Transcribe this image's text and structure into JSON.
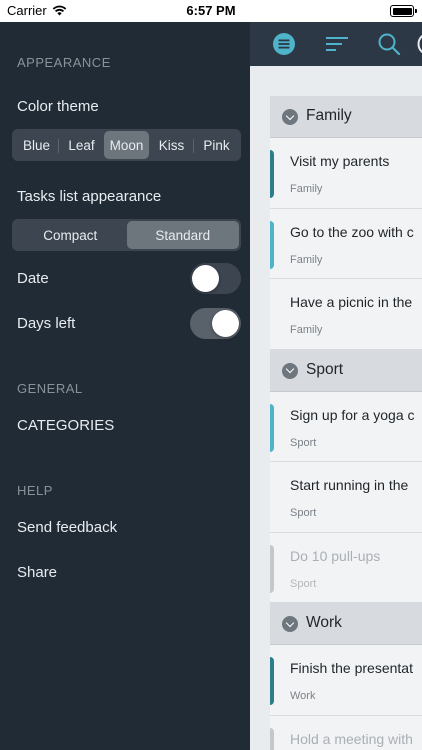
{
  "status_bar": {
    "carrier": "Carrier",
    "time": "6:57 PM"
  },
  "sidebar": {
    "appearance_header": "APPEARANCE",
    "color_theme_label": "Color theme",
    "color_themes": [
      "Blue",
      "Leaf",
      "Moon",
      "Kiss",
      "Pink"
    ],
    "color_theme_selected": "Moon",
    "tasks_list_label": "Tasks list appearance",
    "tasks_list_options": [
      "Compact",
      "Standard"
    ],
    "tasks_list_selected": "Standard",
    "date_label": "Date",
    "date_toggle": false,
    "days_left_label": "Days left",
    "days_left_toggle": true,
    "general_header": "GENERAL",
    "categories_label": "CATEGORIES",
    "help_header": "HELP",
    "send_feedback_label": "Send feedback",
    "share_label": "Share"
  },
  "toolbar": {
    "icons": [
      "menu-icon",
      "sort-icon",
      "search-icon"
    ],
    "accent": "#4fb3c9"
  },
  "categories": [
    {
      "name": "Family",
      "tasks": [
        {
          "title": "Visit my parents",
          "category": "Family",
          "done": false,
          "marker": "#2b7f8c"
        },
        {
          "title": "Go to the zoo with c",
          "category": "Family",
          "done": false,
          "marker": "#4fb3c9"
        },
        {
          "title": "Have a picnic in the",
          "category": "Family",
          "done": false,
          "marker": ""
        }
      ]
    },
    {
      "name": "Sport",
      "tasks": [
        {
          "title": "Sign up for a yoga c",
          "category": "Sport",
          "done": false,
          "marker": "#4fb3c9"
        },
        {
          "title": "Start running in the",
          "category": "Sport",
          "done": false,
          "marker": ""
        },
        {
          "title": "Do 10 pull-ups",
          "category": "Sport",
          "done": true,
          "marker": "#c4c8cc"
        }
      ]
    },
    {
      "name": "Work",
      "tasks": [
        {
          "title": "Finish the presentat",
          "category": "Work",
          "done": false,
          "marker": "#2b7f8c"
        },
        {
          "title": "Hold a meeting with",
          "category": "",
          "done": true,
          "marker": "#c4c8cc"
        }
      ]
    }
  ]
}
